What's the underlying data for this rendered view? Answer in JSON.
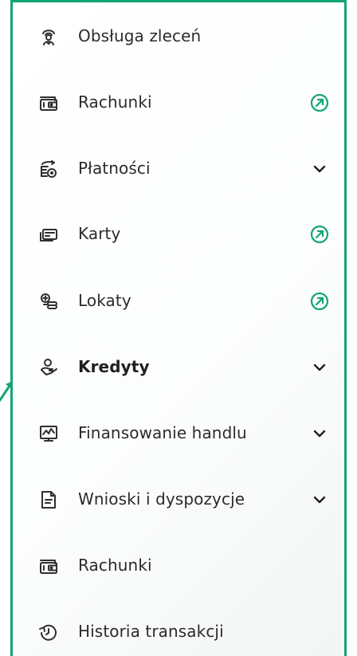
{
  "menu": {
    "items": [
      {
        "label": "Obsługa zleceń",
        "icon": "order-handling-icon",
        "control": "none",
        "bold": false
      },
      {
        "label": "Rachunki",
        "icon": "wallet-icon",
        "control": "external-link",
        "bold": false
      },
      {
        "label": "Płatności",
        "icon": "payments-icon",
        "control": "expand",
        "bold": false
      },
      {
        "label": "Karty",
        "icon": "card-icon",
        "control": "external-link",
        "bold": false
      },
      {
        "label": "Lokaty",
        "icon": "deposits-icon",
        "control": "external-link",
        "bold": false
      },
      {
        "label": "Kredyty",
        "icon": "loans-icon",
        "control": "expand",
        "bold": true
      },
      {
        "label": "Finansowanie handlu",
        "icon": "trade-finance-icon",
        "control": "expand",
        "bold": false
      },
      {
        "label": "Wnioski i dyspozycje",
        "icon": "document-icon",
        "control": "expand",
        "bold": false
      },
      {
        "label": "Rachunki",
        "icon": "wallet-icon",
        "control": "none",
        "bold": false
      },
      {
        "label": "Historia transakcji",
        "icon": "history-icon",
        "control": "none",
        "bold": false
      }
    ]
  },
  "colors": {
    "accent": "#11a66f",
    "text": "#2b2b2b",
    "icon": "#2f2f2f"
  }
}
